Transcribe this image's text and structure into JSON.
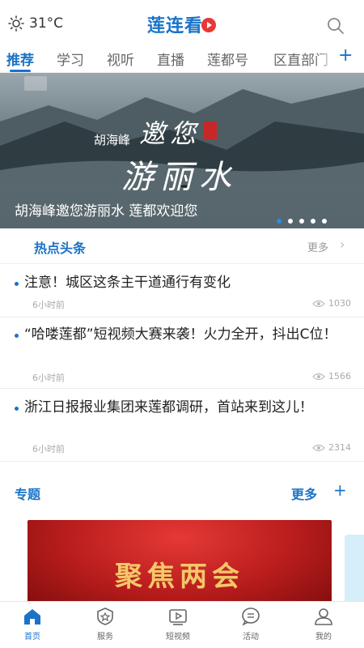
{
  "header": {
    "temperature": "31°C",
    "logo_text": "莲连看",
    "weather_icon": "sun-icon",
    "search_icon": "search-icon"
  },
  "tabs": [
    {
      "label": "推荐",
      "active": true
    },
    {
      "label": "学习",
      "active": false
    },
    {
      "label": "视听",
      "active": false
    },
    {
      "label": "直播",
      "active": false
    },
    {
      "label": "莲都号",
      "active": false
    },
    {
      "label": "区直部门",
      "active": false
    }
  ],
  "tabs_add": "+",
  "banner": {
    "caption": "胡海峰邀您游丽水 莲都欢迎您",
    "calligraphy_small": "胡海峰",
    "calligraphy_line1": "邀您",
    "calligraphy_line2": "游丽水",
    "dots": 5,
    "active_dot": 0
  },
  "hot": {
    "title": "热点头条",
    "more": "更多",
    "items": [
      {
        "title": "注意！城区这条主干道通行有变化",
        "time": "6小时前",
        "views": "1030"
      },
      {
        "title": "“哈喽莲都”短视频大赛来袭！火力全开，抖出C位！",
        "time": "6小时前",
        "views": "1566"
      },
      {
        "title": "浙江日报报业集团来莲都调研，首站来到这儿！",
        "time": "6小时前",
        "views": "2314"
      }
    ]
  },
  "topics": {
    "title": "专题",
    "more": "更多",
    "plus": "+",
    "card_text": "聚焦两会"
  },
  "bottom_nav": [
    {
      "label": "首页",
      "icon": "home-icon",
      "active": true
    },
    {
      "label": "服务",
      "icon": "service-badge-icon",
      "active": false
    },
    {
      "label": "短视频",
      "icon": "video-play-icon",
      "active": false
    },
    {
      "label": "活动",
      "icon": "chat-bubble-icon",
      "active": false
    },
    {
      "label": "我的",
      "icon": "user-icon",
      "active": false
    }
  ],
  "colors": {
    "accent": "#1a73c8",
    "logo_red": "#e53935",
    "topic_gold": "#f5c76a"
  }
}
